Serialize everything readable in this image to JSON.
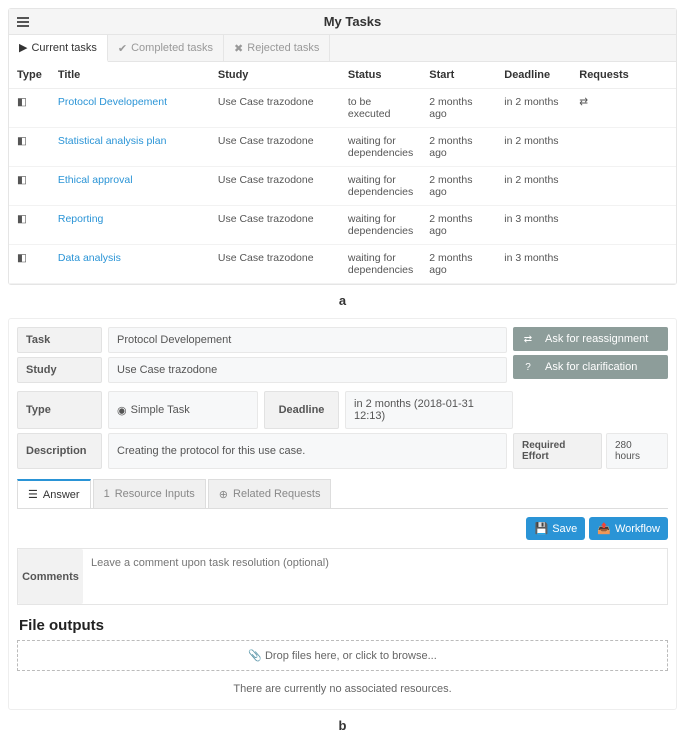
{
  "panelA": {
    "title": "My Tasks",
    "tabs": [
      {
        "label": "Current tasks",
        "active": true
      },
      {
        "label": "Completed tasks",
        "active": false
      },
      {
        "label": "Rejected tasks",
        "active": false
      }
    ],
    "columns": [
      "Type",
      "Title",
      "Study",
      "Status",
      "Start",
      "Deadline",
      "Requests"
    ],
    "rows": [
      {
        "title": "Protocol Developement",
        "study": "Use Case trazodone",
        "status": "to be executed",
        "start": "2 months ago",
        "deadline": "in 2 months",
        "requests": "⇄"
      },
      {
        "title": "Statistical analysis plan",
        "study": "Use Case trazodone",
        "status": "waiting for dependencies",
        "start": "2 months ago",
        "deadline": "in 2 months",
        "requests": ""
      },
      {
        "title": "Ethical approval",
        "study": "Use Case trazodone",
        "status": "waiting for dependencies",
        "start": "2 months ago",
        "deadline": "in 2 months",
        "requests": ""
      },
      {
        "title": "Reporting",
        "study": "Use Case trazodone",
        "status": "waiting for dependencies",
        "start": "2 months ago",
        "deadline": "in 3 months",
        "requests": ""
      },
      {
        "title": "Data analysis",
        "study": "Use Case trazodone",
        "status": "waiting for dependencies",
        "start": "2 months ago",
        "deadline": "in 3 months",
        "requests": ""
      }
    ]
  },
  "figA": "a",
  "panelB": {
    "task_label": "Task",
    "task_value": "Protocol Developement",
    "study_label": "Study",
    "study_value": "Use Case trazodone",
    "type_label": "Type",
    "type_value": "Simple Task",
    "deadline_label": "Deadline",
    "deadline_value": "in 2 months (2018-01-31 12:13)",
    "desc_label": "Description",
    "desc_value": "Creating the protocol for this use case.",
    "effort_label": "Required Effort",
    "effort_value": "280 hours",
    "reassign": "Ask for reassignment",
    "clarify": "Ask for clarification",
    "dtabs": [
      {
        "label": "Answer",
        "count": "",
        "active": true
      },
      {
        "label": "Resource Inputs",
        "count": "1",
        "active": false
      },
      {
        "label": "Related Requests",
        "count": "",
        "active": false
      }
    ],
    "save": "Save",
    "workflow": "Workflow",
    "comments_label": "Comments",
    "comments_placeholder": "Leave a comment upon task resolution (optional)",
    "fileoutputs": "File outputs",
    "dropzone": "Drop files here, or click to browse...",
    "nores": "There are currently no associated resources."
  },
  "figB": "b"
}
